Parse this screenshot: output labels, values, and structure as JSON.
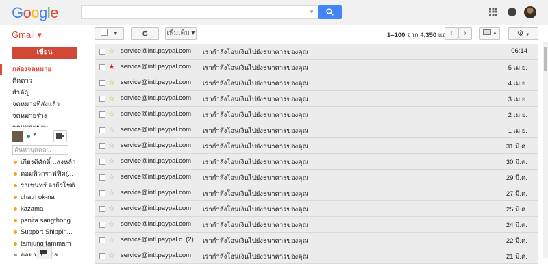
{
  "header": {
    "logo": "Google",
    "logo_colors": [
      "#4285f4",
      "#ea4335",
      "#fbbc05",
      "#4285f4",
      "#34a853",
      "#ea4335"
    ]
  },
  "toolbar": {
    "gmail_label": "Gmail ▾",
    "more_label": "เพิ่มเติม ▾",
    "range_prefix": "1–100",
    "range_middle": " จาก ",
    "range_total": "4,350",
    "range_suffix": " แถว"
  },
  "sidebar": {
    "compose_label": "เขียน",
    "nav": [
      {
        "label": "กล่องจดหมาย",
        "active": true
      },
      {
        "label": "ติดดาว",
        "active": false
      },
      {
        "label": "สำคัญ",
        "active": false
      },
      {
        "label": "จดหมายที่ส่งแล้ว",
        "active": false
      },
      {
        "label": "จดหมายร่าง",
        "active": false
      },
      {
        "label": "จดหมายขยะ",
        "active": false
      }
    ],
    "people_search_placeholder": "ค้นหาบุคคล...",
    "contacts": [
      {
        "name": "เกียรติศักดิ์ แสงหล้า",
        "status": "#f4a41c"
      },
      {
        "name": "คอมพิวกราฟฟิค(...",
        "status": "#f4a41c"
      },
      {
        "name": "ราเชนทร์ จงธีรโชติ",
        "status": "#f4a41c"
      },
      {
        "name": "chatri ok-na",
        "status": "#f4a41c"
      },
      {
        "name": "kazama",
        "status": "#f4a41c"
      },
      {
        "name": "panita sangthong",
        "status": "#f4a41c"
      },
      {
        "name": "Support Shippin...",
        "status": "#f4a41c"
      },
      {
        "name": "tamjung tammam",
        "status": "#f4a41c"
      },
      {
        "name": "ดอยา วิชัยกุล",
        "status": "#999999"
      }
    ]
  },
  "mails": [
    {
      "sender": "service@intl.paypal.com",
      "subject": "เรากำลังโอนเงินไปยังธนาคารของคุณ",
      "date": "06:14",
      "star": "yellow-outline"
    },
    {
      "sender": "service@intl.paypal.com",
      "subject": "เรากำลังโอนเงินไปยังธนาคารของคุณ",
      "date": "5 เม.ย.",
      "star": "red"
    },
    {
      "sender": "service@intl.paypal.com",
      "subject": "เรากำลังโอนเงินไปยังธนาคารของคุณ",
      "date": "4 เม.ย.",
      "star": "yellow-outline"
    },
    {
      "sender": "service@intl.paypal.com",
      "subject": "เรากำลังโอนเงินไปยังธนาคารของคุณ",
      "date": "3 เม.ย.",
      "star": "yellow-outline"
    },
    {
      "sender": "service@intl.paypal.com",
      "subject": "เรากำลังโอนเงินไปยังธนาคารของคุณ",
      "date": "2 เม.ย.",
      "star": "yellow-outline"
    },
    {
      "sender": "service@intl.paypal.com",
      "subject": "เรากำลังโอนเงินไปยังธนาคารของคุณ",
      "date": "1 เม.ย.",
      "star": "yellow-outline"
    },
    {
      "sender": "service@intl.paypal.com",
      "subject": "เรากำลังโอนเงินไปยังธนาคารของคุณ",
      "date": "31 มี.ค.",
      "star": "gray-outline"
    },
    {
      "sender": "service@intl.paypal.com",
      "subject": "เรากำลังโอนเงินไปยังธนาคารของคุณ",
      "date": "30 มี.ค.",
      "star": "gray-outline"
    },
    {
      "sender": "service@intl.paypal.com",
      "subject": "เรากำลังโอนเงินไปยังธนาคารของคุณ",
      "date": "29 มี.ค.",
      "star": "gray-outline"
    },
    {
      "sender": "service@intl.paypal.com",
      "subject": "เรากำลังโอนเงินไปยังธนาคารของคุณ",
      "date": "27 มี.ค.",
      "star": "gray-outline"
    },
    {
      "sender": "service@intl.paypal.com",
      "subject": "เรากำลังโอนเงินไปยังธนาคารของคุณ",
      "date": "25 มี.ค.",
      "star": "gray-outline"
    },
    {
      "sender": "service@intl.paypal.com",
      "subject": "เรากำลังโอนเงินไปยังธนาคารของคุณ",
      "date": "24 มี.ค.",
      "star": "gray-outline"
    },
    {
      "sender": "service@intl.paypal.c. (2)",
      "subject": "เรากำลังโอนเงินไปยังธนาคารของคุณ",
      "date": "22 มี.ค.",
      "star": "gray-outline"
    },
    {
      "sender": "service@intl.paypal.com",
      "subject": "เรากำลังโอนเงินไปยังธนาคารของคุณ",
      "date": "21 มี.ค.",
      "star": "gray-outline"
    }
  ]
}
